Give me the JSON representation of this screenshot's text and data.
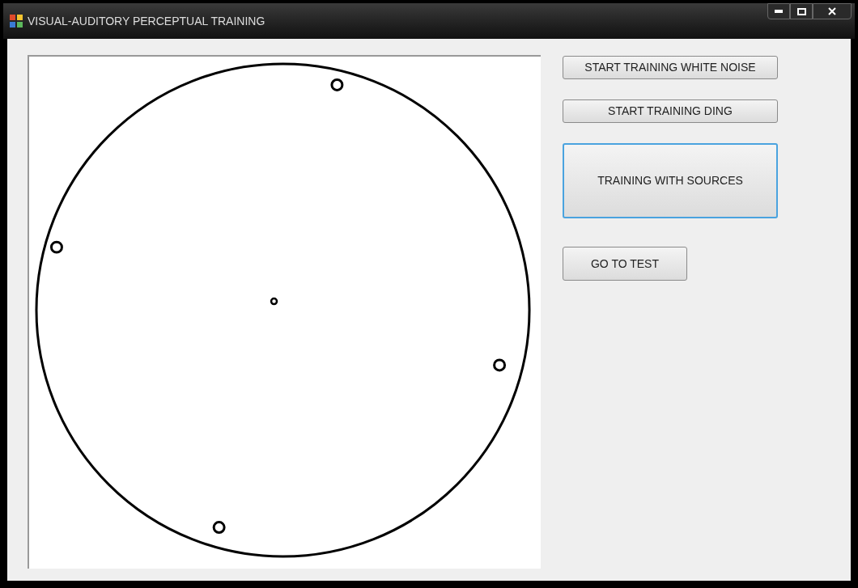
{
  "window": {
    "title": "VISUAL-AUDITORY PERCEPTUAL TRAINING"
  },
  "buttons": [
    {
      "label": "START TRAINING WHITE NOISE",
      "kind": "small",
      "focused": false
    },
    {
      "label": "START TRAINING DING",
      "kind": "small",
      "focused": false
    },
    {
      "label": "TRAINING WITH SOURCES",
      "kind": "large",
      "focused": true
    },
    {
      "label": "GO TO TEST",
      "kind": "short",
      "focused": false
    }
  ]
}
